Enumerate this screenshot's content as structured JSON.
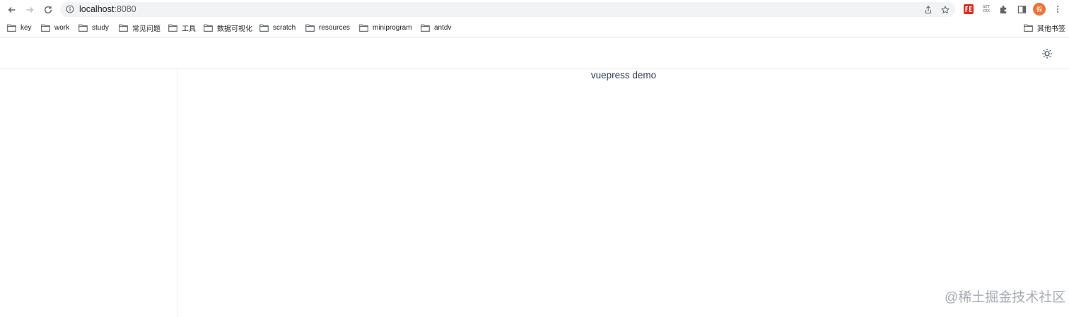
{
  "browser": {
    "url_host": "localhost",
    "url_port": ":8080",
    "avatar_initial": "假",
    "ext_get_crx_top": "GET",
    "ext_get_crx_bottom": "CRX"
  },
  "bookmarks": {
    "items": [
      {
        "label": "key"
      },
      {
        "label": "work"
      },
      {
        "label": "study"
      },
      {
        "label": "常见问题"
      },
      {
        "label": "工具"
      },
      {
        "label": "数据可视化"
      },
      {
        "label": "scratch"
      },
      {
        "label": "resources"
      },
      {
        "label": "miniprogram"
      },
      {
        "label": "antdv"
      }
    ],
    "other": "其他书签"
  },
  "page": {
    "title": "vuepress demo",
    "watermark": "@稀土掘金技术社区"
  },
  "colors": {
    "text": "#2c3e50",
    "border": "#eaecef",
    "accent_avatar": "#e8763a",
    "ext_fe": "#d93025"
  }
}
